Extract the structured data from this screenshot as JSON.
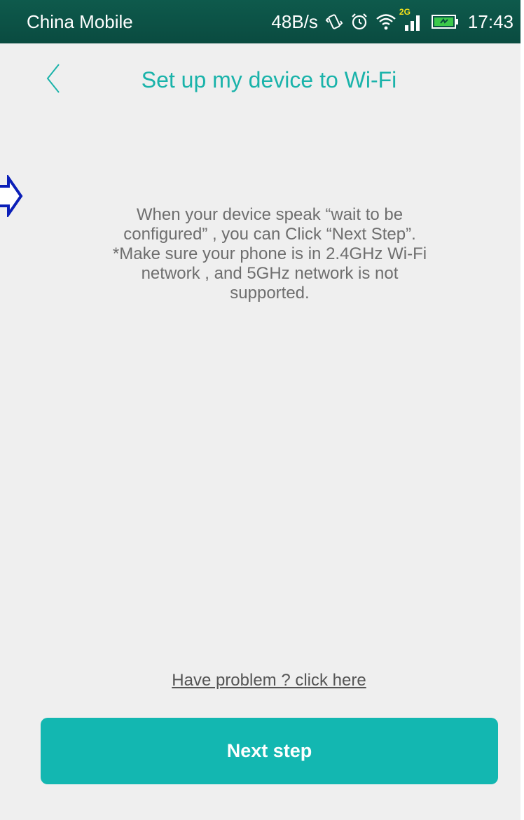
{
  "status_bar": {
    "carrier": "China Mobile",
    "speed": "48B/s",
    "network_badge": "2G",
    "time": "17:43",
    "icons": [
      "vibrate-icon",
      "alarm-icon",
      "wifi-icon",
      "signal-icon",
      "battery-icon"
    ]
  },
  "header": {
    "title": "Set up my device to Wi-Fi",
    "back_icon": "chevron-left-icon"
  },
  "instructions": {
    "line1": "When your device speak “wait to be configured” , you can Click “Next Step”.",
    "line2": "*Make sure your phone is in 2.4GHz Wi-Fi network , and 5GHz network is not supported."
  },
  "help": {
    "link_text": "Have problem ? click here"
  },
  "footer": {
    "next_label": "Next step"
  },
  "colors": {
    "accent": "#1ab3aa",
    "button": "#13b7b1",
    "status_bar": "#0a4b40",
    "background": "#efefef",
    "pointer": "#0b1fb8"
  }
}
